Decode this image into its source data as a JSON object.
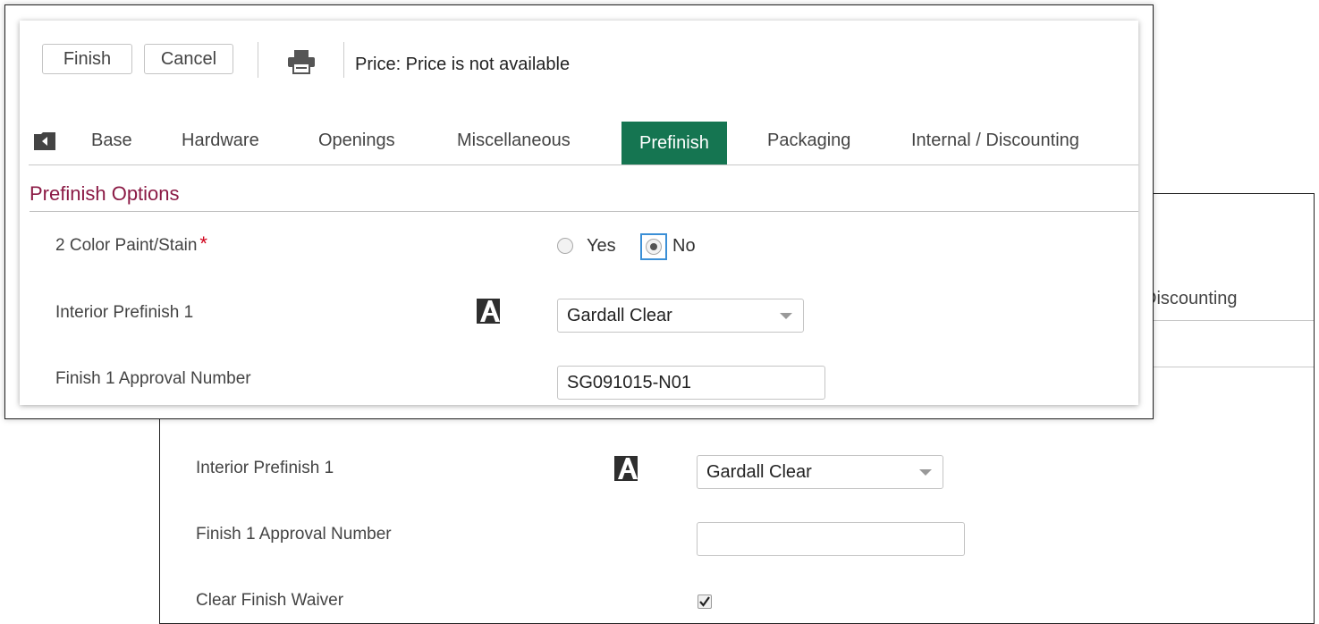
{
  "toolbar": {
    "finish_label": "Finish",
    "cancel_label": "Cancel",
    "print_icon": "printer-icon",
    "price_text": "Price: Price is not available"
  },
  "tabs": {
    "nav_icon": "back-folder-icon",
    "items": [
      {
        "label": "Base",
        "active": false
      },
      {
        "label": "Hardware",
        "active": false
      },
      {
        "label": "Openings",
        "active": false
      },
      {
        "label": "Miscellaneous",
        "active": false
      },
      {
        "label": "Prefinish",
        "active": true
      },
      {
        "label": "Packaging",
        "active": false
      },
      {
        "label": "Internal / Discounting",
        "active": false
      }
    ]
  },
  "section": {
    "title": "Prefinish Options"
  },
  "fields": {
    "two_color": {
      "label": "2 Color Paint/Stain",
      "required_mark": "*",
      "options": [
        "Yes",
        "No"
      ],
      "selected": "No"
    },
    "interior_prefinish": {
      "label": "Interior Prefinish 1",
      "icon": "a-logo-icon",
      "value": "Gardall Clear"
    },
    "approval_number": {
      "label": "Finish 1 Approval Number",
      "value": "SG091015-N01"
    }
  },
  "background_window": {
    "tab_fragment": "Discounting",
    "interior_prefinish_label": "Interior Prefinish 1",
    "interior_prefinish_value": "Gardall Clear",
    "approval_label": "Finish 1 Approval Number",
    "approval_value": "",
    "waiver_label": "Clear Finish Waiver",
    "waiver_checked": true
  },
  "colors": {
    "active_tab": "#157551",
    "section_title": "#8b1a45",
    "required": "#d0021b",
    "focus": "#3b8fd6"
  }
}
